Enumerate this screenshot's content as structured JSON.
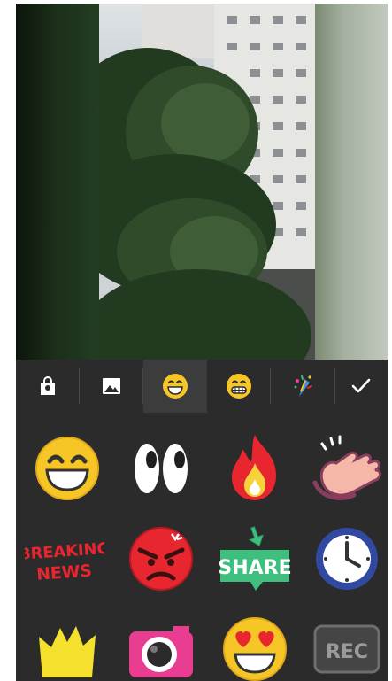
{
  "toolbar": {
    "tabs": [
      {
        "id": "store",
        "icon": "shopping-bag-icon",
        "selected": false
      },
      {
        "id": "gallery",
        "icon": "image-icon",
        "selected": false
      },
      {
        "id": "emoji-a",
        "icon": "grinning-face-icon",
        "selected": true
      },
      {
        "id": "emoji-b",
        "icon": "grimacing-face-icon",
        "selected": false
      },
      {
        "id": "effects",
        "icon": "party-popper-icon",
        "selected": false
      }
    ],
    "confirm_icon": "checkmark-icon"
  },
  "stickers": [
    {
      "name": "sticker-grin"
    },
    {
      "name": "sticker-eyes"
    },
    {
      "name": "sticker-fire"
    },
    {
      "name": "sticker-wave-hand"
    },
    {
      "name": "sticker-breaking-news",
      "line1": "BREAKING",
      "line2": "NEWS"
    },
    {
      "name": "sticker-angry"
    },
    {
      "name": "sticker-share",
      "label": "SHARE"
    },
    {
      "name": "sticker-clock"
    },
    {
      "name": "sticker-crown"
    },
    {
      "name": "sticker-camera"
    },
    {
      "name": "sticker-heart-eyes"
    },
    {
      "name": "sticker-rec",
      "label": "REC"
    }
  ],
  "colors": {
    "panel_bg": "#2b2b2b",
    "tab_selected_bg": "#3c3c3c",
    "emoji_yellow": "#f5c626",
    "news_red": "#e8262f",
    "share_green": "#3dbf7d",
    "clock_blue": "#2f4aa0",
    "camera_pink": "#e93d91"
  }
}
